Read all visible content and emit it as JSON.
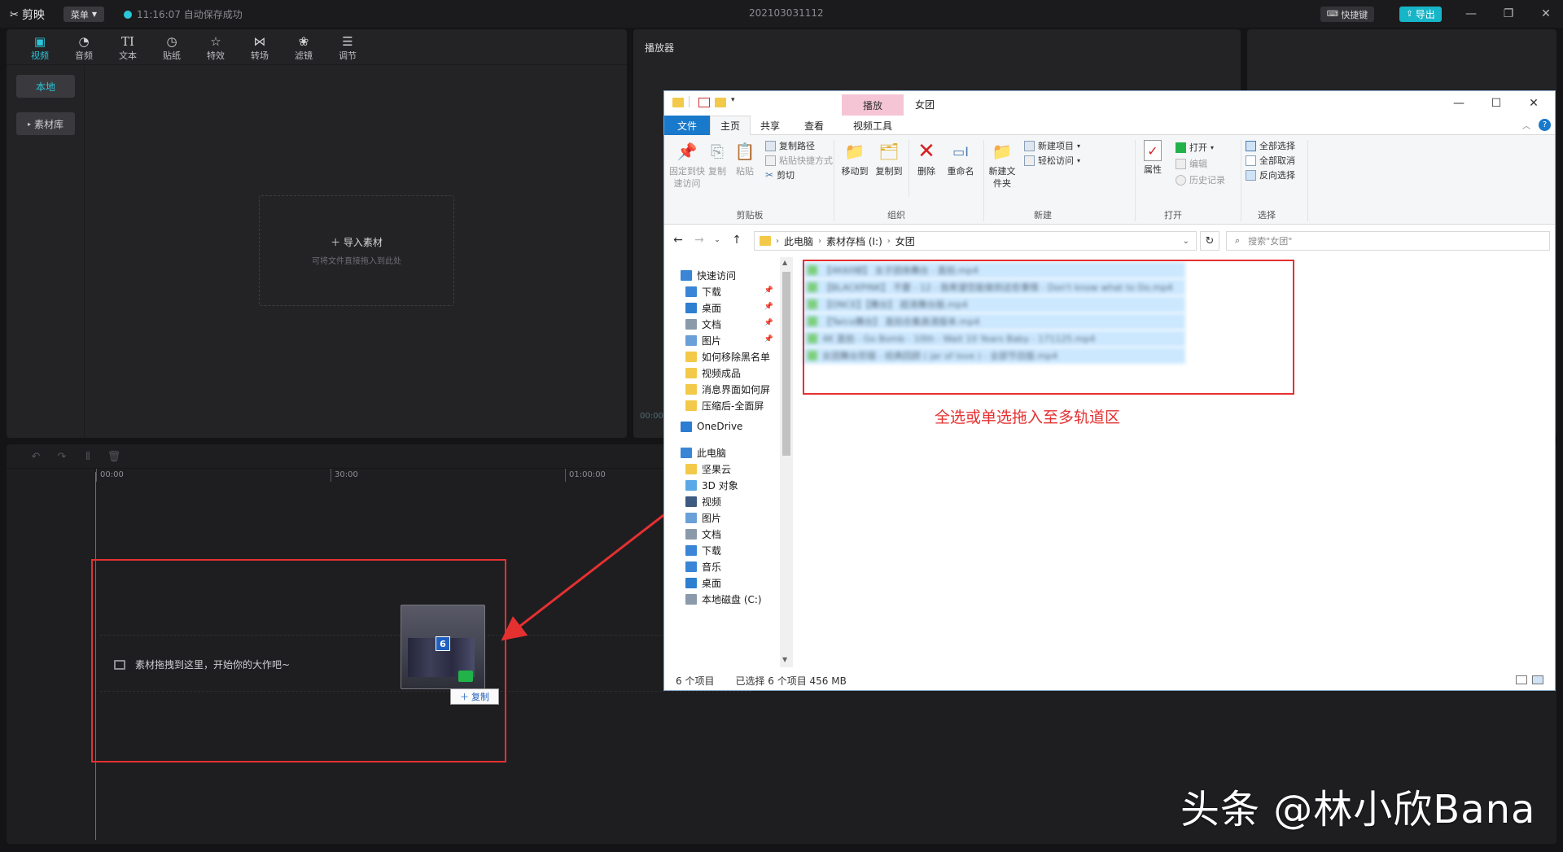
{
  "app": {
    "name": "剪映",
    "menu_label": "菜单",
    "save_status": "11:16:07 自动保存成功",
    "project_title": "202103031112",
    "shortcut_label": "快捷键",
    "export_label": "导出",
    "accent_color": "#2cc6d9"
  },
  "tools": [
    {
      "label": "视频",
      "icon": "video-icon"
    },
    {
      "label": "音频",
      "icon": "audio-icon"
    },
    {
      "label": "文本",
      "icon": "text-icon"
    },
    {
      "label": "贴纸",
      "icon": "sticker-icon"
    },
    {
      "label": "特效",
      "icon": "effects-icon"
    },
    {
      "label": "转场",
      "icon": "transition-icon"
    },
    {
      "label": "滤镜",
      "icon": "filter-icon"
    },
    {
      "label": "调节",
      "icon": "adjust-icon"
    }
  ],
  "media": {
    "local_label": "本地",
    "library_label": "素材库",
    "import_title": "导入素材",
    "import_hint": "可将文件直接拖入到此处"
  },
  "player": {
    "title": "播放器",
    "timecode": "00:00"
  },
  "timeline": {
    "ruler": [
      "00:00",
      "30:00",
      "01:00:00"
    ],
    "track_hint": "素材拖拽到这里，开始你的大作吧~",
    "drag_count": "6",
    "copy_tip": "复制"
  },
  "explorer": {
    "window_title": "女团",
    "context_tab": "播放",
    "tabs": [
      "文件",
      "主页",
      "共享",
      "查看",
      "视频工具"
    ],
    "clipboard": {
      "pin": "固定到快速访问",
      "copy": "复制",
      "paste": "粘贴",
      "copy_path": "复制路径",
      "paste_shortcut": "粘贴快捷方式",
      "cut": "剪切",
      "group": "剪贴板"
    },
    "organize": {
      "move_to": "移动到",
      "copy_to": "复制到",
      "delete": "删除",
      "rename": "重命名",
      "group": "组织"
    },
    "new": {
      "new_folder": "新建文件夹",
      "new_item": "新建项目",
      "easy_access": "轻松访问",
      "group": "新建"
    },
    "open": {
      "properties": "属性",
      "open": "打开",
      "edit": "编辑",
      "history": "历史记录",
      "group": "打开"
    },
    "select": {
      "select_all": "全部选择",
      "select_none": "全部取消",
      "invert": "反向选择",
      "group": "选择"
    },
    "breadcrumb": [
      "此电脑",
      "素材存档 (I:)",
      "女团"
    ],
    "search_placeholder": "搜索\"女团\"",
    "nav": [
      {
        "label": "快速访问",
        "icon": "star-icon",
        "indent": 0
      },
      {
        "label": "下载",
        "icon": "download-icon",
        "indent": 1,
        "pinned": true
      },
      {
        "label": "桌面",
        "icon": "desktop-icon",
        "indent": 1,
        "pinned": true
      },
      {
        "label": "文档",
        "icon": "document-icon",
        "indent": 1,
        "pinned": true
      },
      {
        "label": "图片",
        "icon": "picture-icon",
        "indent": 1,
        "pinned": true
      },
      {
        "label": "如何移除黑名单",
        "icon": "folder-icon",
        "indent": 1
      },
      {
        "label": "视频成品",
        "icon": "folder-icon",
        "indent": 1
      },
      {
        "label": "消息界面如何屏",
        "icon": "folder-icon",
        "indent": 1
      },
      {
        "label": "压缩后-全面屏",
        "icon": "folder-icon",
        "indent": 1
      },
      {
        "label": "OneDrive",
        "icon": "cloud-icon",
        "indent": 0
      },
      {
        "label": "此电脑",
        "icon": "computer-icon",
        "indent": 0
      },
      {
        "label": "坚果云",
        "icon": "folder-icon",
        "indent": 1
      },
      {
        "label": "3D 对象",
        "icon": "cube-icon",
        "indent": 1
      },
      {
        "label": "视频",
        "icon": "video-folder-icon",
        "indent": 1
      },
      {
        "label": "图片",
        "icon": "picture-icon",
        "indent": 1
      },
      {
        "label": "文档",
        "icon": "document-icon",
        "indent": 1
      },
      {
        "label": "下载",
        "icon": "download-icon",
        "indent": 1
      },
      {
        "label": "音乐",
        "icon": "music-icon",
        "indent": 1
      },
      {
        "label": "桌面",
        "icon": "desktop-icon",
        "indent": 1
      },
      {
        "label": "本地磁盘 (C:)",
        "icon": "drive-icon",
        "indent": 1
      }
    ],
    "files": [
      "【4K60帧】 女子团体舞台 - 直拍.mp4",
      "【BLACKPINK】 不要 - 12 - 我希望您能做到这些事情 - Don't know what to Do.mp4",
      "【ONCE】【舞台】 超清舞台版.mp4",
      "【Twice舞台】 直拍合集高清版本.mp4",
      "4K 直拍 - Go Bomb - 10th - Wait 10 Years Baby - 171125.mp4",
      "女团舞台剪辑 - 经典回顾 ( jar of love ) - 全部节目版.mp4"
    ],
    "status_count": "6 个项目",
    "status_selected": "已选择 6 个项目  456 MB"
  },
  "annotation": {
    "caption": "全选或单选拖入至多轨道区",
    "color": "#e53030"
  },
  "watermark": "头条 @林小欣Bana"
}
